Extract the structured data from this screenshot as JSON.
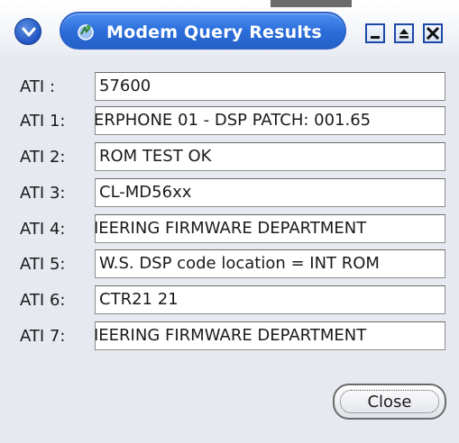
{
  "window": {
    "title": "Modem Query Results"
  },
  "rows": [
    {
      "label": "ATI :",
      "value": "57600"
    },
    {
      "label": "ATI 1:",
      "value": "ERPHONE 01 - DSP PATCH: 001.65"
    },
    {
      "label": "ATI 2:",
      "value": "ROM TEST OK"
    },
    {
      "label": "ATI 3:",
      "value": "CL-MD56xx"
    },
    {
      "label": "ATI 4:",
      "value": "IEERING  FIRMWARE DEPARTMENT"
    },
    {
      "label": "ATI 5:",
      "value": "W.S.   DSP code location = INT ROM"
    },
    {
      "label": "ATI 6:",
      "value": "CTR21 21"
    },
    {
      "label": "ATI 7:",
      "value": "IEERING  FIRMWARE DEPARTMENT"
    }
  ],
  "buttons": {
    "close": "Close"
  },
  "colors": {
    "titlebar_blue": "#2c6fdb",
    "window_bg": "#e6e9ef"
  }
}
